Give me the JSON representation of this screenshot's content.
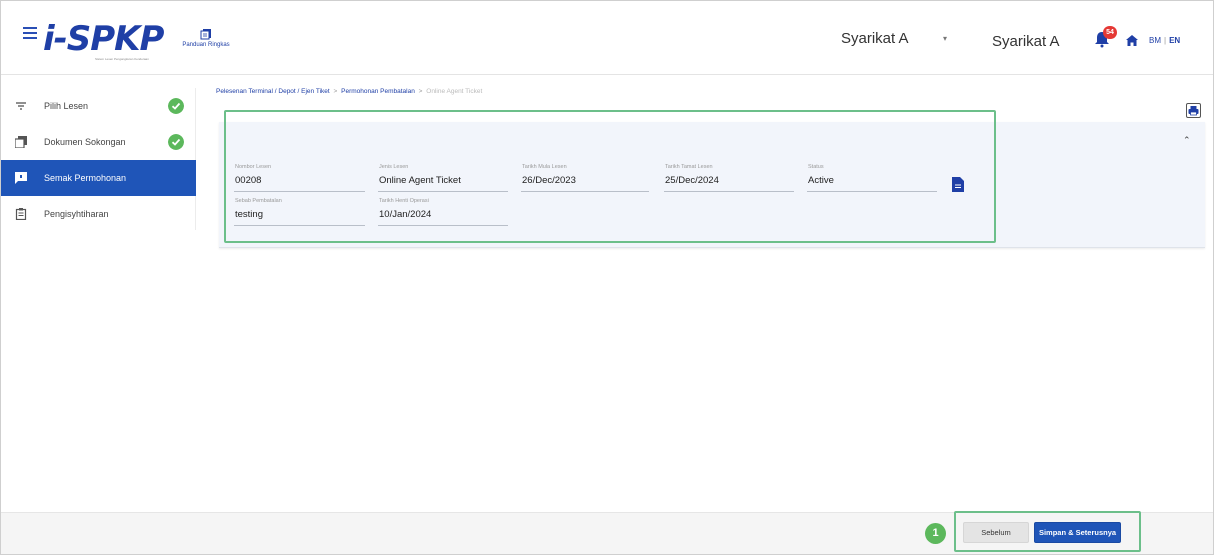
{
  "header": {
    "logo_text": "i-SPKP",
    "logo_subtitle": "Sistem Lesen Pengangkutan Kenderaan",
    "guide_label": "Panduan Ringkas",
    "company_select": "Syarikat A",
    "company_name": "Syarikat A",
    "notification_count": "54",
    "lang_bm": "BM",
    "lang_sep": "|",
    "lang_en": "EN",
    "brand_color": "#1f3fa6"
  },
  "sidebar": {
    "items": [
      {
        "label": "Pilih Lesen",
        "icon": "filter-icon",
        "completed": true
      },
      {
        "label": "Dokumen Sokongan",
        "icon": "documents-icon",
        "completed": true
      },
      {
        "label": "Semak Permohonan",
        "icon": "review-icon",
        "active": true
      },
      {
        "label": "Pengisyhtiharan",
        "icon": "clipboard-icon"
      }
    ],
    "active_color": "#1f55b8"
  },
  "breadcrumb": {
    "item1": "Pelesenan Terminal / Depot / Ejen Tiket",
    "sep": ">",
    "item2": "Permohonan Pembatalan",
    "current": "Online Agent Ticket"
  },
  "form": {
    "nombor_lesen": {
      "label": "Nombor Lesen",
      "value": "00208"
    },
    "jenis_lesen": {
      "label": "Jenis Lesen",
      "value": "Online Agent Ticket"
    },
    "tarikh_mula": {
      "label": "Tarikh Mula Lesen",
      "value": "26/Dec/2023"
    },
    "tarikh_tamat": {
      "label": "Tarikh Tamat Lesen",
      "value": "25/Dec/2024"
    },
    "status": {
      "label": "Status",
      "value": "Active"
    },
    "sebab": {
      "label": "Sebab Pembatalan",
      "value": "testing"
    },
    "tarikh_henti": {
      "label": "Tarikh Henti Operasi",
      "value": "10/Jan/2024"
    }
  },
  "footer": {
    "step_number": "1",
    "prev_label": "Sebelum",
    "next_label": "Simpan & Seterusnya",
    "highlight_color": "#6cbf8a"
  }
}
